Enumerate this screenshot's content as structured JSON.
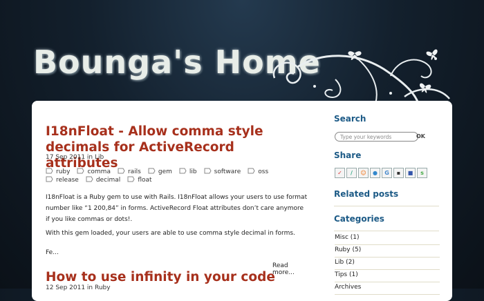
{
  "site": {
    "title": "Bounga's Home"
  },
  "posts": [
    {
      "title": "I18nFloat - Allow comma style decimals for ActiveRecord attributes",
      "meta": "17 Sep 2011 in Lib",
      "tags": [
        "ruby",
        "comma",
        "rails",
        "gem",
        "lib",
        "software",
        "oss",
        "release",
        "decimal",
        "float"
      ],
      "paragraphs": [
        "I18nFloat is a Ruby gem to use with Rails. I18nFloat allows your users to use format number like “1 200,84” in forms. ActiveRecord Float attributes don’t care anymore if you like commas or dots!.",
        "With this gem loaded, your users are able to use comma style decimal in forms.",
        "Fe..."
      ],
      "read_more": "Read more..."
    },
    {
      "title": "How to use infinity in your code",
      "meta": "12 Sep 2011 in Ruby"
    }
  ],
  "sidebar": {
    "search": {
      "title": "Search",
      "placeholder": "Type your keywords",
      "button": "OK"
    },
    "share": {
      "title": "Share",
      "icons": [
        "delicious-icon",
        "digg-icon",
        "reddit-icon",
        "technorati-icon",
        "google-icon",
        "delicious-squares-icon",
        "facebook-icon",
        "stumbleupon-icon"
      ]
    },
    "related": {
      "title": "Related posts"
    },
    "categories": {
      "title": "Categories",
      "items": [
        "Misc (1)",
        "Ruby (5)",
        "Lib (2)",
        "Tips (1)",
        "Archives"
      ]
    }
  },
  "colors": {
    "title": "#a7301c",
    "widget_title": "#1c5a86",
    "background": "#13202d"
  }
}
